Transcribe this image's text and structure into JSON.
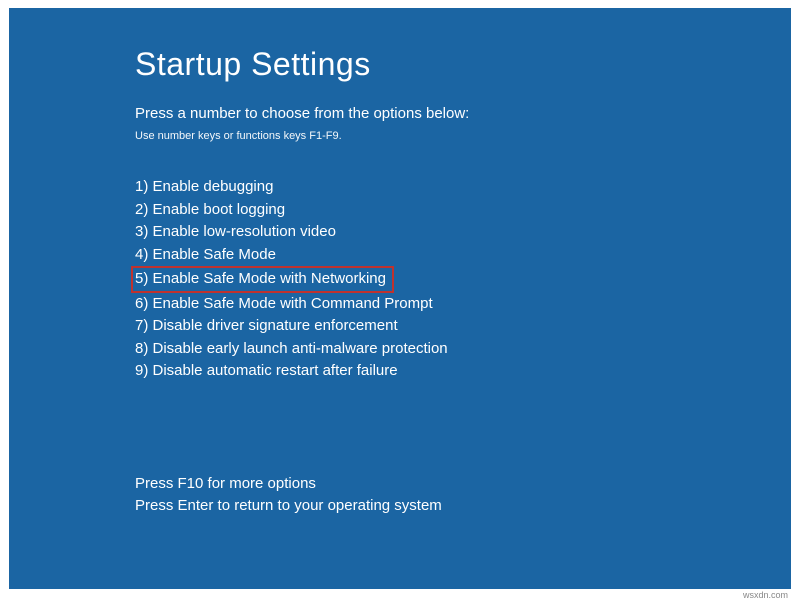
{
  "title": "Startup Settings",
  "prompt": "Press a number to choose from the options below:",
  "hint": "Use number keys or functions keys F1-F9.",
  "options": [
    {
      "num": "1",
      "label": "Enable debugging",
      "highlighted": false
    },
    {
      "num": "2",
      "label": "Enable boot logging",
      "highlighted": false
    },
    {
      "num": "3",
      "label": "Enable low-resolution video",
      "highlighted": false
    },
    {
      "num": "4",
      "label": "Enable Safe Mode",
      "highlighted": false
    },
    {
      "num": "5",
      "label": "Enable Safe Mode with Networking",
      "highlighted": true
    },
    {
      "num": "6",
      "label": "Enable Safe Mode with Command Prompt",
      "highlighted": false
    },
    {
      "num": "7",
      "label": "Disable driver signature enforcement",
      "highlighted": false
    },
    {
      "num": "8",
      "label": "Disable early launch anti-malware protection",
      "highlighted": false
    },
    {
      "num": "9",
      "label": "Disable automatic restart after failure",
      "highlighted": false
    }
  ],
  "footer": {
    "more": "Press F10 for more options",
    "return": "Press Enter to return to your operating system"
  },
  "watermark": "wsxdn.com"
}
